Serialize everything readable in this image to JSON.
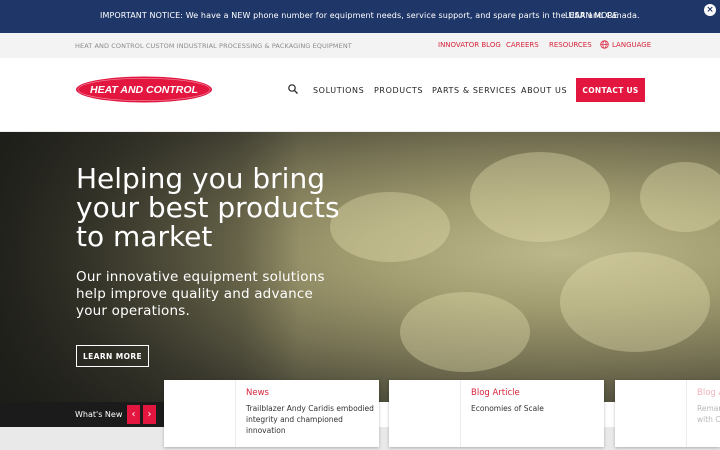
{
  "notice": {
    "text": "IMPORTANT NOTICE: We have a NEW phone number for equipment needs, service support, and spare parts in the USA and Canada.",
    "link": "LEARN MORE",
    "close": "×"
  },
  "utility": {
    "tagline": "HEAT AND CONTROL CUSTOM INDUSTRIAL PROCESSING & PACKAGING EQUIPMENT",
    "links": [
      "INNOVATOR BLOG",
      "CAREERS",
      "RESOURCES",
      "LANGUAGE"
    ]
  },
  "header": {
    "logo_text": "HEAT AND CONTROL",
    "nav": [
      "SOLUTIONS",
      "PRODUCTS",
      "PARTS & SERVICES",
      "ABOUT US"
    ],
    "contact": "CONTACT US"
  },
  "hero": {
    "title": "Helping you bring your best products to market",
    "subtitle": "Our innovative equipment solutions help improve quality and advance your operations.",
    "button": "LEARN MORE"
  },
  "whats_new": {
    "label": "What's New",
    "prev": "‹",
    "next": "›"
  },
  "cards": [
    {
      "category": "News",
      "title": "Trailblazer Andy Caridis embodied integrity and championed innovation"
    },
    {
      "category": "Blog Article",
      "title": "Economies of Scale"
    },
    {
      "category": "Blog A",
      "title": "Remar with C"
    }
  ],
  "colors": {
    "notice_bg": "#1f3768",
    "brand_red": "#e3163f",
    "link_red": "#d6243b"
  }
}
